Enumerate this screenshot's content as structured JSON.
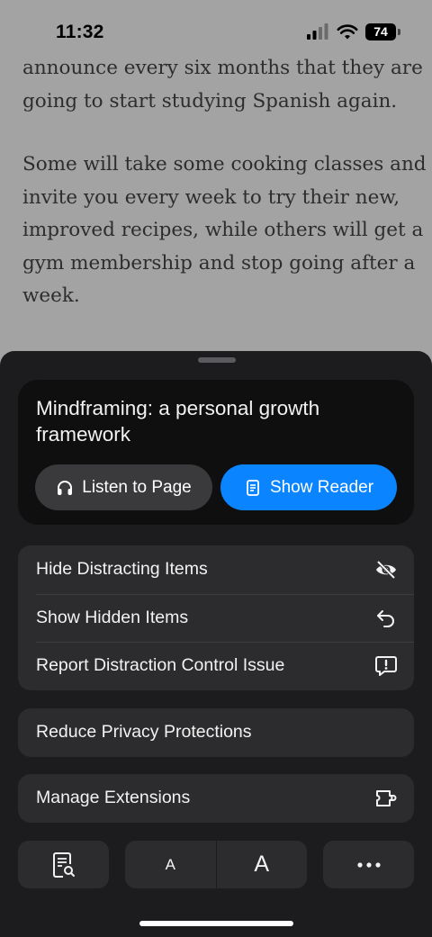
{
  "status_bar": {
    "time": "11:32",
    "battery": "74"
  },
  "article": {
    "paragraphs": [
      [
        "announce every six months that they are",
        "going to start studying Spanish again."
      ],
      [
        "Some will take some cooking classes and",
        "invite you every week to try their new,",
        "improved recipes, while others will get a",
        "gym membership and stop going after a",
        "week."
      ]
    ]
  },
  "sheet": {
    "page_title": "Mindframing: a personal growth framework",
    "listen_label": "Listen to Page",
    "reader_label": "Show Reader",
    "distraction_group": [
      {
        "label": "Hide Distracting Items",
        "icon": "eye-slash-icon"
      },
      {
        "label": "Show Hidden Items",
        "icon": "undo-arrow-icon"
      },
      {
        "label": "Report Distraction Control Issue",
        "icon": "report-bubble-icon"
      }
    ],
    "privacy_label": "Reduce Privacy Protections",
    "extensions_label": "Manage Extensions",
    "toolbar": {
      "font_small": "A",
      "font_large": "A"
    }
  },
  "colors": {
    "accent": "#0a84ff",
    "sheet_bg": "#1c1c1e",
    "row_bg": "#2c2c2e"
  }
}
